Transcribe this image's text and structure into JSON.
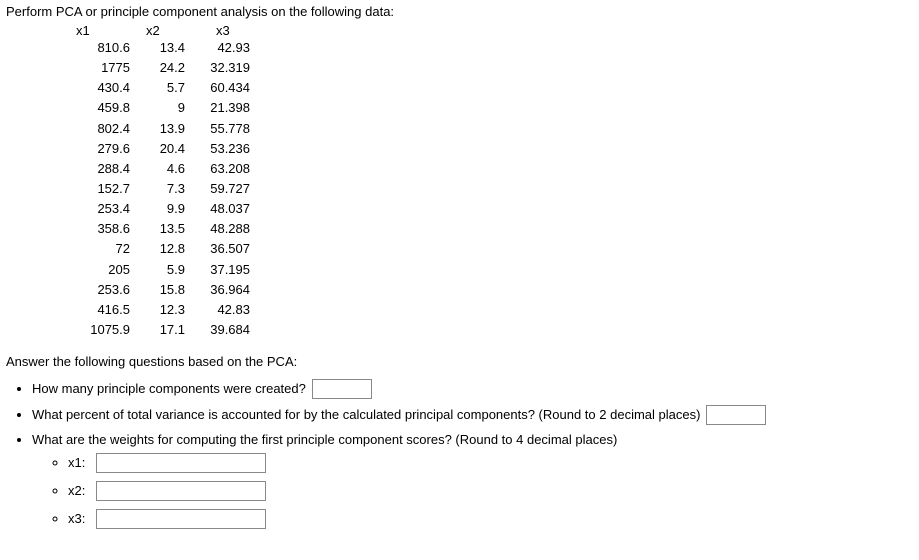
{
  "intro": "Perform PCA or principle component analysis on the following data:",
  "headers": {
    "x1": "x1",
    "x2": "x2",
    "x3": "x3"
  },
  "rows": [
    {
      "x1": "810.6",
      "x2": "13.4",
      "x3": "42.93"
    },
    {
      "x1": "1775",
      "x2": "24.2",
      "x3": "32.319"
    },
    {
      "x1": "430.4",
      "x2": "5.7",
      "x3": "60.434"
    },
    {
      "x1": "459.8",
      "x2": "9",
      "x3": "21.398"
    },
    {
      "x1": "802.4",
      "x2": "13.9",
      "x3": "55.778"
    },
    {
      "x1": "279.6",
      "x2": "20.4",
      "x3": "53.236"
    },
    {
      "x1": "288.4",
      "x2": "4.6",
      "x3": "63.208"
    },
    {
      "x1": "152.7",
      "x2": "7.3",
      "x3": "59.727"
    },
    {
      "x1": "253.4",
      "x2": "9.9",
      "x3": "48.037"
    },
    {
      "x1": "358.6",
      "x2": "13.5",
      "x3": "48.288"
    },
    {
      "x1": "72",
      "x2": "12.8",
      "x3": "36.507"
    },
    {
      "x1": "205",
      "x2": "5.9",
      "x3": "37.195"
    },
    {
      "x1": "253.6",
      "x2": "15.8",
      "x3": "36.964"
    },
    {
      "x1": "416.5",
      "x2": "12.3",
      "x3": "42.83"
    },
    {
      "x1": "1075.9",
      "x2": "17.1",
      "x3": "39.684"
    }
  ],
  "prompt2": "Answer the following questions based on the PCA:",
  "questions": {
    "q1": "How many principle components were created?",
    "q2": "What percent of total variance is accounted for by the calculated principal components? (Round to 2 decimal places)",
    "q3": "What are the weights for computing the first principle component scores? (Round to 4 decimal places)",
    "sub": {
      "x1": "x1:",
      "x2": "x2:",
      "x3": "x3:"
    }
  }
}
